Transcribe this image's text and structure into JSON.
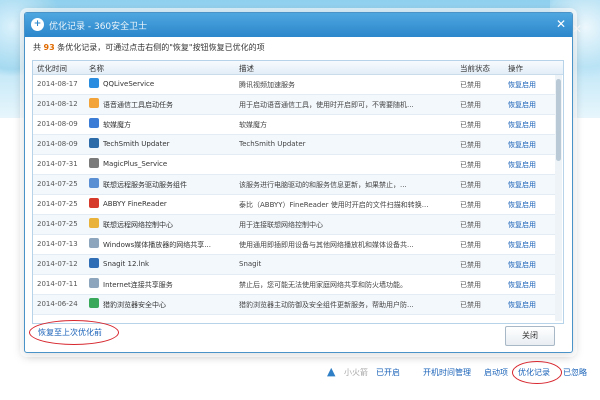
{
  "dialog": {
    "title": "优化记录 - 360安全卫士",
    "info_prefix": "共",
    "count": "93",
    "info_suffix": "条优化记录，可通过点击右侧的\"恢复\"按钮恢复已优化的项",
    "columns": [
      "优化时间",
      "名称",
      "描述",
      "当前状态",
      "操作"
    ],
    "rows": [
      {
        "date": "2014-08-17",
        "name": "QQLiveService",
        "desc": "腾讯视频加速服务",
        "status": "已禁用",
        "action": "恢复启用",
        "icon_color": "#2a8de0"
      },
      {
        "date": "2014-08-12",
        "name": "语音通信工具启动任务",
        "desc": "用于启动语音通信工具，使用时开启即可，不需要随机...",
        "status": "已禁用",
        "action": "恢复启用",
        "icon_color": "#f2a43a"
      },
      {
        "date": "2014-08-09",
        "name": "软媒魔方",
        "desc": "软媒魔方",
        "status": "已禁用",
        "action": "恢复启用",
        "icon_color": "#3b7cd6"
      },
      {
        "date": "2014-08-09",
        "name": "TechSmith Updater",
        "desc": "TechSmith Updater",
        "status": "已禁用",
        "action": "恢复启用",
        "icon_color": "#2c6aa8"
      },
      {
        "date": "2014-07-31",
        "name": "MagicPlus_Service",
        "desc": "",
        "status": "已禁用",
        "action": "恢复启用",
        "icon_color": "#7a7a7a"
      },
      {
        "date": "2014-07-25",
        "name": "联想远程服务驱动服务组件",
        "desc": "该服务进行电脑驱动的和服务信息更新，如果禁止，...",
        "status": "已禁用",
        "action": "恢复启用",
        "icon_color": "#5b8fd3"
      },
      {
        "date": "2014-07-25",
        "name": "ABBYY FineReader",
        "desc": "泰比（ABBYY）FineReader 使用时开启的文件扫描和转换...",
        "status": "已禁用",
        "action": "恢复启用",
        "icon_color": "#d63a2a"
      },
      {
        "date": "2014-07-25",
        "name": "联想远程网络控制中心",
        "desc": "用于连接联想网络控制中心",
        "status": "已禁用",
        "action": "恢复启用",
        "icon_color": "#e9b23a"
      },
      {
        "date": "2014-07-13",
        "name": "Windows媒体播放器的网络共享...",
        "desc": "使用通用即插即用设备与其他网络播放机和媒体设备共...",
        "status": "已禁用",
        "action": "恢复启用",
        "icon_color": "#8da6bd"
      },
      {
        "date": "2014-07-12",
        "name": "Snagit 12.lnk",
        "desc": "Snagit",
        "status": "已禁用",
        "action": "恢复启用",
        "icon_color": "#2f6db5"
      },
      {
        "date": "2014-07-11",
        "name": "Internet连接共享服务",
        "desc": "禁止后，您可能无法使用家庭网络共享和防火墙功能。",
        "status": "已禁用",
        "action": "恢复启用",
        "icon_color": "#8da6bd"
      },
      {
        "date": "2014-06-24",
        "name": "猎豹浏览器安全中心",
        "desc": "猎豹浏览器主动防御及安全组件更新服务，帮助用户防...",
        "status": "已禁用",
        "action": "恢复启用",
        "icon_color": "#3aa85a"
      }
    ],
    "restore_link": "恢复至上次优化前",
    "close_button": "关闭"
  },
  "bottom_bar": {
    "items": [
      {
        "label": "小火箭",
        "gray": true
      },
      {
        "label": "已开启",
        "gray": false
      },
      {
        "label": "开机时间管理",
        "gray": false
      },
      {
        "label": "启动项",
        "gray": false
      },
      {
        "label": "优化记录",
        "gray": false
      },
      {
        "label": "已忽略",
        "gray": false
      }
    ]
  },
  "colors": {
    "accent": "#2b86cb",
    "link": "#1a62b8",
    "highlight_circle": "#d7262e",
    "count": "#e06a00"
  }
}
